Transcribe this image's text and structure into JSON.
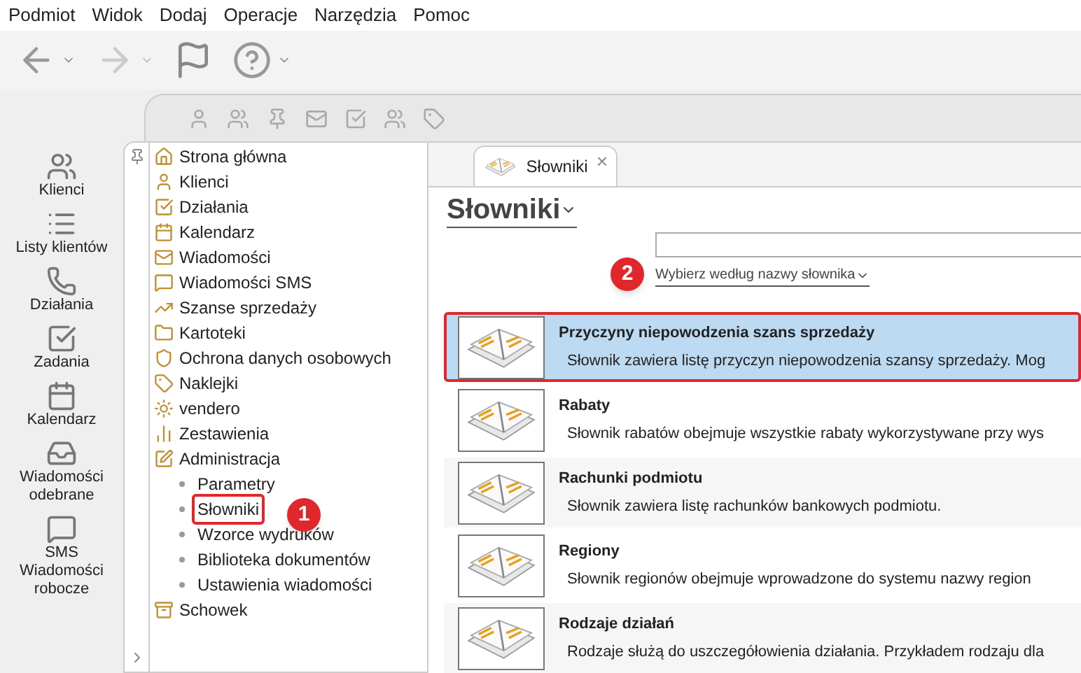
{
  "menu": [
    "Podmiot",
    "Widok",
    "Dodaj",
    "Operacje",
    "Narzędzia",
    "Pomoc"
  ],
  "sidebar": {
    "items": [
      {
        "label": "Klienci",
        "kind": "clients"
      },
      {
        "label": "Listy klientów",
        "kind": "list"
      },
      {
        "label": "Działania",
        "kind": "actions"
      },
      {
        "label": "Zadania",
        "kind": "tasks"
      },
      {
        "label": "Kalendarz",
        "kind": "calendar"
      },
      {
        "label": "Wiadomości odebrane",
        "kind": "inbox"
      },
      {
        "label": "SMS Wiadomości robocze",
        "kind": "sms"
      }
    ]
  },
  "tree": [
    {
      "label": "Strona główna",
      "selected": false
    },
    {
      "label": "Klienci",
      "selected": false
    },
    {
      "label": "Działania",
      "selected": false
    },
    {
      "label": "Kalendarz",
      "selected": false
    },
    {
      "label": "Wiadomości",
      "selected": false
    },
    {
      "label": "Wiadomości SMS",
      "selected": false
    },
    {
      "label": "Szanse sprzedaży",
      "selected": false
    },
    {
      "label": "Kartoteki",
      "selected": false
    },
    {
      "label": "Ochrona danych osobowych",
      "selected": false
    },
    {
      "label": "Naklejki",
      "selected": false
    },
    {
      "label": "vendero",
      "selected": false
    },
    {
      "label": "Zestawienia",
      "selected": false
    },
    {
      "label": "Administracja",
      "selected": false,
      "children": [
        {
          "label": "Parametry",
          "selected": false
        },
        {
          "label": "Słowniki",
          "selected": true
        },
        {
          "label": "Wzorce wydruków",
          "selected": false
        },
        {
          "label": "Biblioteka dokumentów",
          "selected": false
        },
        {
          "label": "Ustawienia wiadomości",
          "selected": false
        }
      ]
    },
    {
      "label": "Schowek",
      "selected": false
    }
  ],
  "tab": {
    "label": "Słowniki",
    "close": "×"
  },
  "heading": "Słowniki",
  "filter": {
    "link": "Wybierz według nazwy słownika"
  },
  "dictionaries": [
    {
      "title": "Przyczyny niepowodzenia szans sprzedaży",
      "description": "Słownik zawiera listę przyczyn niepowodzenia szansy sprzedaży. Mog",
      "selected": true
    },
    {
      "title": "Rabaty",
      "description": "Słownik rabatów obejmuje wszystkie rabaty wykorzystywane przy wys",
      "selected": false
    },
    {
      "title": "Rachunki podmiotu",
      "description": "Słownik zawiera listę rachunków bankowych podmiotu.",
      "selected": false
    },
    {
      "title": "Regiony",
      "description": "Słownik regionów obejmuje wprowadzone do systemu nazwy region",
      "selected": false
    },
    {
      "title": "Rodzaje działań",
      "description": "Rodzaje służą do uszczegółowienia działania. Przykładem rodzaju dla",
      "selected": false
    }
  ],
  "callouts": [
    "1",
    "2"
  ]
}
